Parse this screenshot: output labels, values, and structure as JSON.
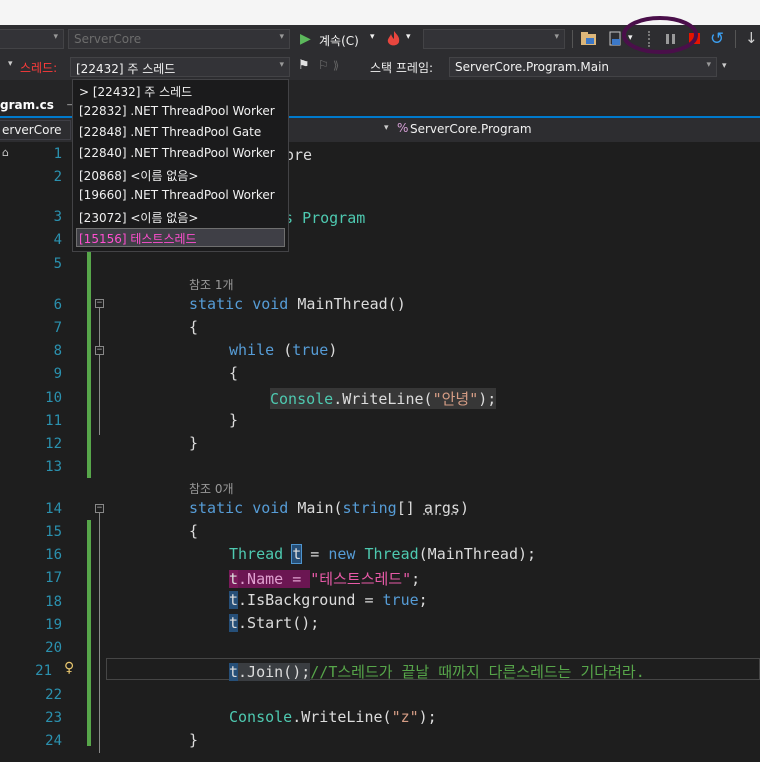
{
  "toolbar": {
    "config_combo": "ServerCore",
    "continue_label": "계속(C)",
    "continue_arrow": "▾",
    "blank_combo": ""
  },
  "debug_location": {
    "thread_label": "스레드:",
    "thread_value": "[22432] 주 스레드",
    "stack_frame_label": "스택 프레임:",
    "stack_frame_value": "ServerCore.Program.Main"
  },
  "thread_dropdown": {
    "items": [
      "> [22432] 주 스레드",
      "[22832] .NET ThreadPool Worker",
      "[22848] .NET ThreadPool Gate",
      "[22840] .NET ThreadPool Worker",
      "[20868] <이름 없음>",
      "[19660] .NET ThreadPool Worker",
      "[23072] <이름 없음>",
      "[15156] 테스트스레드"
    ],
    "selected_index": 7
  },
  "tabs": {
    "file_tab": "gram.cs",
    "pin_glyph": "⊣"
  },
  "nav": {
    "project": "erverCore",
    "class_path": "ServerCore.Program"
  },
  "editor": {
    "line_numbers": [
      "1",
      "2",
      "3",
      "4",
      "5",
      "6",
      "7",
      "8",
      "9",
      "10",
      "11",
      "12",
      "13",
      "14",
      "15",
      "16",
      "17",
      "18",
      "19",
      "20",
      "21",
      "22",
      "23",
      "24"
    ],
    "ref_1": "참조 1개",
    "ref_0": "참조 0개",
    "lines": {
      "l1_tail": "ore",
      "l3_kw": "s",
      "l3_name": "Program",
      "l6": [
        "static",
        "void",
        "MainThread()"
      ],
      "l7": "{",
      "l8": [
        "while",
        "(",
        "true",
        ")"
      ],
      "l9": "{",
      "l10": [
        "Console",
        ".WriteLine(",
        "\"안녕\"",
        ");"
      ],
      "l11": "}",
      "l12": "}",
      "l14": [
        "static",
        "void",
        "Main(",
        "string",
        "[] ",
        "args",
        ")"
      ],
      "l15": "{",
      "l16": [
        "Thread",
        "t",
        "=",
        "new",
        "Thread",
        "(MainThread);"
      ],
      "l17": [
        "t",
        ".Name = ",
        "\"테스트스레드\"",
        ";"
      ],
      "l18": [
        "t",
        ".IsBackground = ",
        "true",
        ";"
      ],
      "l19": [
        "t",
        ".Start();"
      ],
      "l21": [
        "t",
        ".Join();",
        "//T스레드가 끝날 때까지 다른스레드는 기다려라."
      ],
      "l23": [
        "Console",
        ".WriteLine(",
        "\"z\"",
        ");"
      ],
      "l24": "}"
    }
  },
  "colors": {
    "keyword": "#569cd6",
    "type": "#4ec9b0",
    "string": "#d69d85",
    "comment": "#57a64a",
    "line_number": "#2b91af",
    "accent": "#007acc"
  }
}
